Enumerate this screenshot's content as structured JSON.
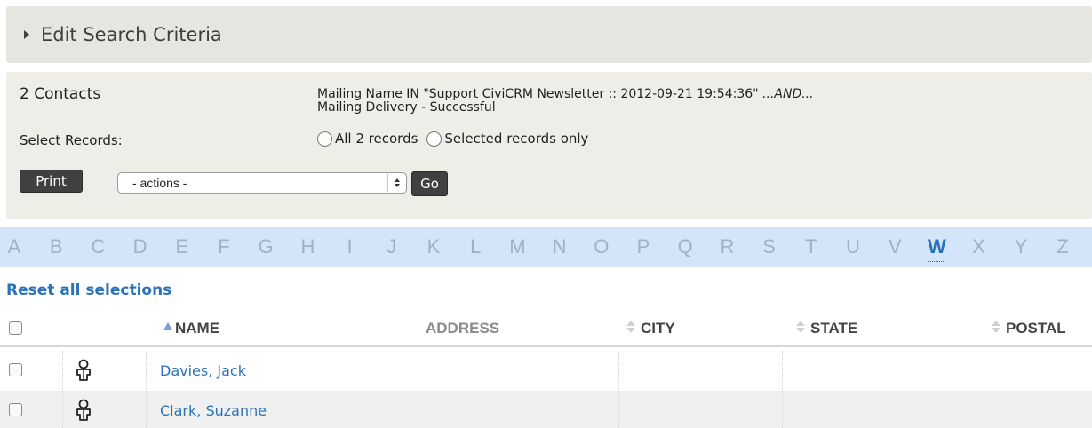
{
  "search_criteria": {
    "title": "Edit Search Criteria"
  },
  "results": {
    "count_label": "2 Contacts",
    "criteria_line1": "Mailing Name IN \"Support CiviCRM Newsletter :: 2012-09-21 19:54:36\"",
    "criteria_line1_suffix": "...AND...",
    "criteria_line2": "Mailing Delivery - Successful",
    "select_records_label": "Select Records:",
    "radio_all_label": "All 2 records",
    "radio_selected_label": "Selected records only",
    "print_label": "Print",
    "actions_value": "- actions -",
    "go_label": "Go"
  },
  "alphabet": {
    "letters": [
      "A",
      "B",
      "C",
      "D",
      "E",
      "F",
      "G",
      "H",
      "I",
      "J",
      "K",
      "L",
      "M",
      "N",
      "O",
      "P",
      "Q",
      "R",
      "S",
      "T",
      "U",
      "V",
      "W",
      "X",
      "Y",
      "Z"
    ],
    "active": "W"
  },
  "reset_label": "Reset all selections",
  "table": {
    "headers": {
      "name": "NAME",
      "address": "ADDRESS",
      "city": "CITY",
      "state": "STATE",
      "postal": "POSTAL"
    },
    "rows": [
      {
        "name": "Davies, Jack",
        "icon": "individual-contact-icon"
      },
      {
        "name": "Clark, Suzanne",
        "icon": "individual-contact-icon"
      }
    ]
  },
  "colors": {
    "link": "#2b73b9",
    "alpha_bar": "#d4e5fa",
    "panel": "#eeede7",
    "button": "#404040"
  }
}
